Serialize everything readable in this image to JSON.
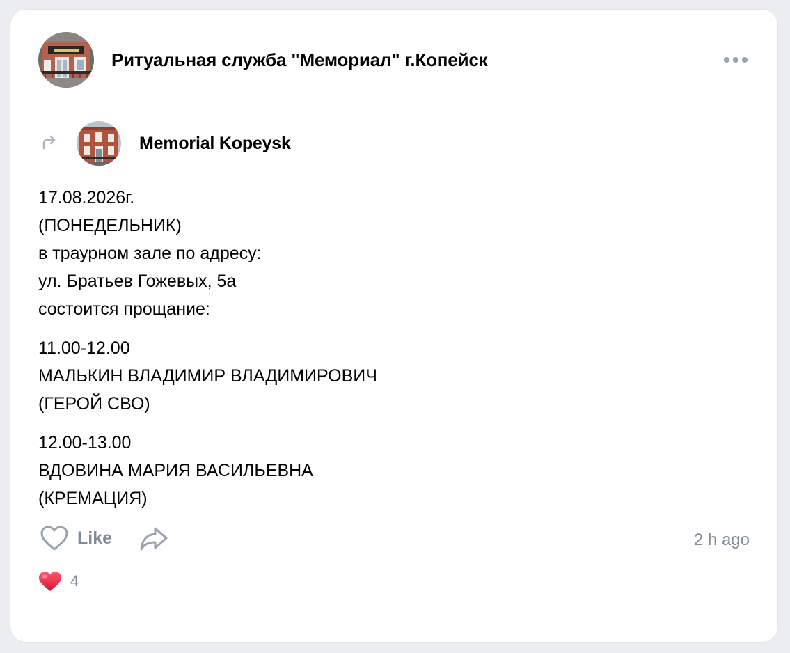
{
  "post": {
    "group_name": "Ритуальная служба \"Мемориал\" г.Копейск",
    "group_avatar_icon": "storefront-photo",
    "more_icon": "more-horizontal-icon",
    "repost": {
      "icon": "repost-arrow-icon",
      "author_name": "Memorial Kopeysk",
      "author_avatar_icon": "building-photo"
    },
    "text": {
      "intro": {
        "line1": "17.08.2026г.",
        "line2": "(ПОНЕДЕЛЬНИК)",
        "line3": "в траурном зале по адресу:",
        "line4": "ул. Братьев Гожевых, 5а",
        "line5": "состоится прощание:"
      },
      "entry1": {
        "time": "11.00-12.00",
        "name": "МАЛЬКИН ВЛАДИМИР ВЛАДИМИРОВИЧ",
        "note": "(ГЕРОЙ СВО)"
      },
      "entry2": {
        "time": "12.00-13.00",
        "name": "ВДОВИНА МАРИЯ ВАСИЛЬЕВНА",
        "note": "(КРЕМАЦИЯ)"
      }
    },
    "actions": {
      "like_label": "Like",
      "like_icon": "heart-outline-icon",
      "share_icon": "share-arrow-icon",
      "timestamp": "2 h ago"
    },
    "reactions": {
      "icon": "red-heart-icon",
      "count": "4"
    },
    "colors": {
      "background": "#ebedf0",
      "card": "#ffffff",
      "secondary_text": "#818c99",
      "icon_gray": "#99a2ad",
      "heart_red": "#e8254a"
    }
  }
}
